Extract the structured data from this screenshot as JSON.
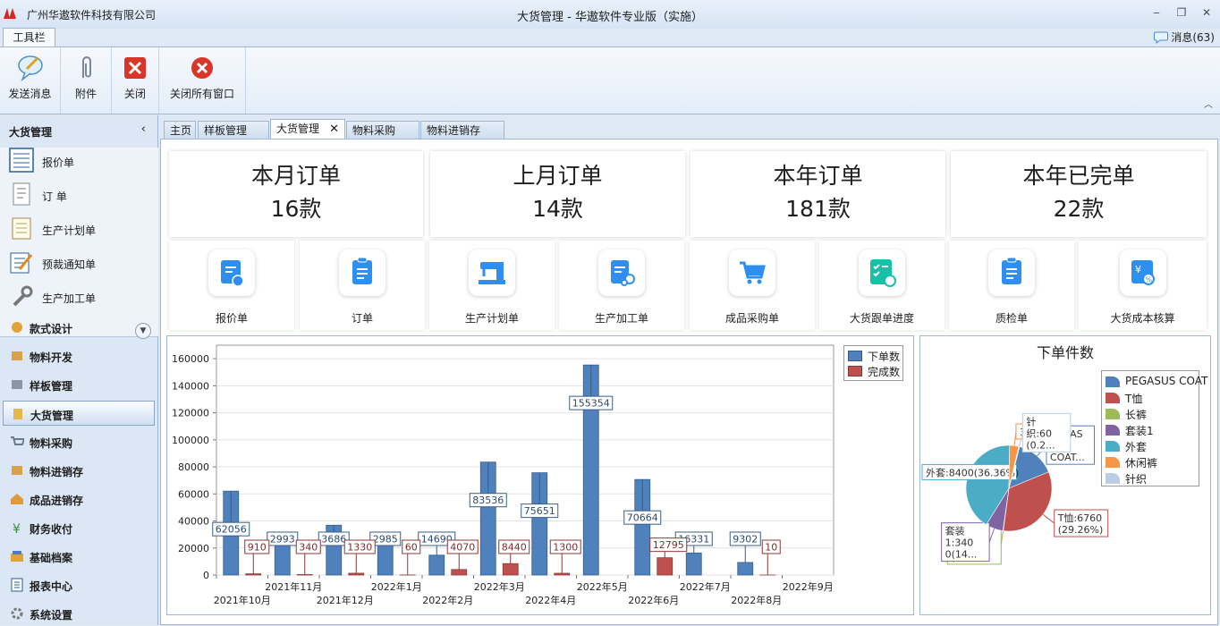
{
  "window": {
    "company": "广州华遨软件科技有限公司",
    "title": "大货管理 - 华遨软件专业版（实施）",
    "controls": [
      "‒",
      "❐",
      "✕"
    ]
  },
  "ribbon": {
    "tab": "工具栏",
    "messages": "消息(63)",
    "buttons": [
      {
        "label": "发送消息",
        "icon": "send-message-icon"
      },
      {
        "label": "附件",
        "icon": "paperclip-icon"
      },
      {
        "label": "关闭",
        "icon": "close-red-icon"
      },
      {
        "label": "关闭所有窗口",
        "icon": "close-all-icon"
      }
    ]
  },
  "nav": {
    "header": "大货管理",
    "sub_items": [
      "报价单",
      "订  单",
      "生产计划单",
      "预裁通知单",
      "生产加工单"
    ],
    "modules": [
      "款式设计",
      "物料开发",
      "样板管理",
      "大货管理",
      "物料采购",
      "物料进销存",
      "成品进销存",
      "财务收付",
      "基础档案",
      "报表中心",
      "系统设置"
    ],
    "active_module": "大货管理"
  },
  "tabs": [
    "主页",
    "样板管理",
    "大货管理",
    "物料采购",
    "物料进销存"
  ],
  "active_tab": "大货管理",
  "stats": [
    {
      "title": "本月订单",
      "value": "16款"
    },
    {
      "title": "上月订单",
      "value": "14款"
    },
    {
      "title": "本年订单",
      "value": "181款"
    },
    {
      "title": "本年已完单",
      "value": "22款"
    }
  ],
  "quick_links": [
    "报价单",
    "订单",
    "生产计划单",
    "生产加工单",
    "成品采购单",
    "大货跟单进度",
    "质检单",
    "大货成本核算"
  ],
  "colors": {
    "bar_order": "#4f81bd",
    "bar_done": "#c0504d",
    "quick_icon": "#2f8ff0"
  },
  "chart_data": [
    {
      "type": "bar",
      "categories": [
        "2021年10月",
        "2021年11月",
        "2021年12月",
        "2022年1月",
        "2022年2月",
        "2022年3月",
        "2022年4月",
        "2022年5月",
        "2022年6月",
        "2022年7月",
        "2022年8月",
        "2022年9月"
      ],
      "series": [
        {
          "name": "下单数",
          "values": [
            62056,
            29935,
            36865,
            29855,
            14690,
            83536,
            75651,
            155354,
            70664,
            16331,
            9302,
            0
          ],
          "labels": [
            "62056",
            "2993",
            "3686",
            "2985",
            "14690",
            "83536",
            "75651",
            "155354",
            "70664",
            "16331",
            "9302",
            ""
          ]
        },
        {
          "name": "完成数",
          "values": [
            910,
            340,
            1330,
            60,
            4070,
            8440,
            1300,
            0,
            12795,
            0,
            10,
            0
          ],
          "labels": [
            "910",
            "340",
            "1330",
            "60",
            "4070",
            "8440",
            "1300",
            "",
            "12795",
            "",
            "10",
            ""
          ]
        }
      ],
      "yticks": [
        "0",
        "20000",
        "40000",
        "60000",
        "80000",
        "100000",
        "120000",
        "140000",
        "160000"
      ],
      "ylim": [
        0,
        170000
      ],
      "legend_position": "top-right",
      "grid": true
    },
    {
      "type": "pie",
      "title": "下单件数",
      "slices": [
        {
          "name": "PEGASUS COAT",
          "value": 3000,
          "label": "PEGAS\nUS\nCOAT...",
          "color": "#4f81bd"
        },
        {
          "name": "T恤",
          "value": 6760,
          "label": "T恤:6760\n(29.26%)",
          "color": "#c0504d"
        },
        {
          "name": "长裤",
          "value": 30,
          "label": "长\n裤:30\n(0.13...",
          "color": "#9bbb59"
        },
        {
          "name": "套装1",
          "value": 1340,
          "label": "套装\n1:340\n0(14...",
          "color": "#8064a2"
        },
        {
          "name": "外套",
          "value": 8400,
          "label": "外套:8400(36.36%)",
          "color": "#4bacc6"
        },
        {
          "name": "休闲裤",
          "value": 700,
          "label": "30(4...",
          "color": "#f79646"
        },
        {
          "name": "针织",
          "value": 60,
          "label": "针\n织:60\n(0.2...",
          "color": "#b9cde5"
        }
      ],
      "legend_position": "right"
    }
  ]
}
